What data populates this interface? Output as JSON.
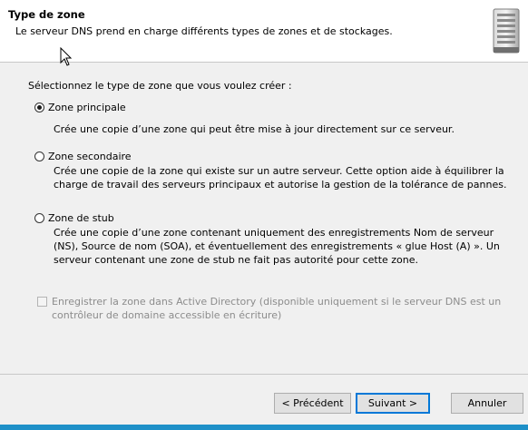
{
  "header": {
    "title": "Type de zone",
    "subtitle": "Le serveur DNS prend en charge différents types de zones et de stockages.",
    "icon": "server-icon"
  },
  "prompt": "Sélectionnez le type de zone que vous voulez créer :",
  "options": [
    {
      "label": "Zone principale",
      "checked": true,
      "description": "Crée une copie d’une zone qui peut être mise à jour directement sur ce serveur."
    },
    {
      "label": "Zone secondaire",
      "checked": false,
      "description": "Crée une copie de la zone qui existe sur un autre serveur. Cette option aide à équilibrer la charge de travail des serveurs principaux et autorise la gestion de la tolérance de pannes."
    },
    {
      "label": "Zone de stub",
      "checked": false,
      "description": "Crée une copie d’une zone contenant uniquement des enregistrements Nom de serveur (NS), Source de nom (SOA), et éventuellement des enregistrements « glue Host (A) ». Un serveur contenant une zone de stub ne fait pas autorité pour cette zone."
    }
  ],
  "ad_checkbox": {
    "label": "Enregistrer la zone dans Active Directory (disponible uniquement si le serveur DNS est un contrôleur de domaine accessible en écriture)",
    "checked": false,
    "enabled": false
  },
  "buttons": {
    "back": "< Précédent",
    "next": "Suivant >",
    "cancel": "Annuler"
  },
  "colors": {
    "accent": "#0078d7",
    "bottom_bar": "#1e90c8"
  }
}
